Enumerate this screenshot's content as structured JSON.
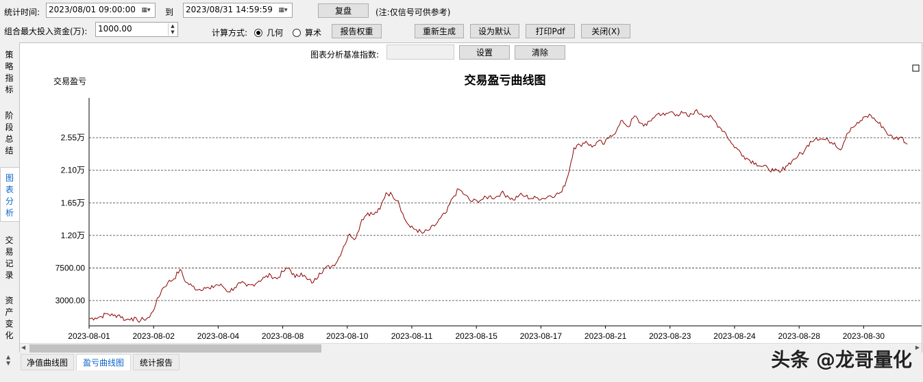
{
  "toolbar": {
    "stat_time_label": "统计时间:",
    "start_time": "2023/08/01 09:00:00",
    "to_label": "到",
    "end_time": "2023/08/31 14:59:59",
    "replay_button": "复盘",
    "note": "(注:仅信号可供参考)",
    "max_capital_label": "组合最大投入资金(万):",
    "max_capital_value": "1000.00",
    "calc_method_label": "计算方式:",
    "calc_geometric": "几何",
    "calc_arithmetic": "算术",
    "calc_selected": "geometric",
    "report_weight_button": "报告权重",
    "regenerate_button": "重新生成",
    "set_default_button": "设为默认",
    "print_pdf_button": "打印Pdf",
    "close_button": "关闭(X)"
  },
  "chart_toolbar": {
    "base_index_label": "图表分析基准指数:",
    "base_index_value": "",
    "set_button": "设置",
    "clear_button": "清除"
  },
  "side_tabs": [
    {
      "label": "策略指标",
      "active": false
    },
    {
      "label": "阶段总结",
      "active": false
    },
    {
      "label": "图表分析",
      "active": true
    },
    {
      "label": "交易记录",
      "active": false
    },
    {
      "label": "资产变化",
      "active": false
    }
  ],
  "bottom_tabs": [
    {
      "label": "净值曲线图",
      "active": false
    },
    {
      "label": "盈亏曲线图",
      "active": true
    },
    {
      "label": "统计报告",
      "active": false
    }
  ],
  "watermark": "头条 @龙哥量化",
  "colors": {
    "line": "#8b0000",
    "active_tab": "#0a64c8"
  },
  "chart_data": {
    "type": "line",
    "title": "交易盈亏曲线图",
    "ylabel": "交易盈亏",
    "xlabel": "",
    "grid": "horizontal-dashed",
    "ylim": [
      -500,
      31000
    ],
    "y_ticks": [
      {
        "value": 3000,
        "label": "3000.00"
      },
      {
        "value": 7500,
        "label": "7500.00"
      },
      {
        "value": 12000,
        "label": "1.20万"
      },
      {
        "value": 16500,
        "label": "1.65万"
      },
      {
        "value": 21000,
        "label": "2.10万"
      },
      {
        "value": 25500,
        "label": "2.55万"
      }
    ],
    "x_ticks": [
      "2023-08-01",
      "2023-08-02",
      "2023-08-04",
      "2023-08-08",
      "2023-08-10",
      "2023-08-11",
      "2023-08-15",
      "2023-08-17",
      "2023-08-21",
      "2023-08-23",
      "2023-08-24",
      "2023-08-28",
      "2023-08-30"
    ],
    "series": [
      {
        "values": [
          500,
          600,
          800,
          1200,
          900,
          1000,
          300,
          600,
          200,
          400,
          700,
          2500,
          4500,
          5500,
          6000,
          7300,
          5500,
          5000,
          4500,
          4800,
          4600,
          5200,
          5000,
          4200,
          4800,
          5400,
          5000,
          5200,
          5700,
          6200,
          6500,
          6000,
          7000,
          7500,
          6200,
          6800,
          5900,
          5500,
          6800,
          7500,
          7700,
          8500,
          10500,
          12200,
          11600,
          14200,
          15100,
          14900,
          15600,
          17900,
          17600,
          16800,
          14400,
          13100,
          12800,
          12300,
          12700,
          13300,
          14400,
          15200,
          17200,
          18400,
          17600,
          16700,
          16800,
          17000,
          17400,
          17200,
          17900,
          17500,
          16900,
          17600,
          17400,
          17100,
          17200,
          17100,
          17500,
          17600,
          18000,
          20200,
          24100,
          24500,
          25000,
          24200,
          25000,
          24600,
          25800,
          26400,
          27900,
          27000,
          28500,
          27500,
          27200,
          28200,
          28900,
          28600,
          29100,
          28700,
          28900,
          28400,
          29200,
          28800,
          28500,
          28000,
          27000,
          26200,
          24700,
          23900,
          23000,
          22400,
          22000,
          21500,
          21300,
          20900,
          20700,
          21600,
          22300,
          23000,
          23600,
          25000,
          25500,
          25300,
          25100,
          24800,
          23800,
          26000,
          26900,
          27500,
          28400,
          28600,
          27700,
          27000,
          25800,
          25400,
          25600,
          24600
        ]
      }
    ]
  }
}
